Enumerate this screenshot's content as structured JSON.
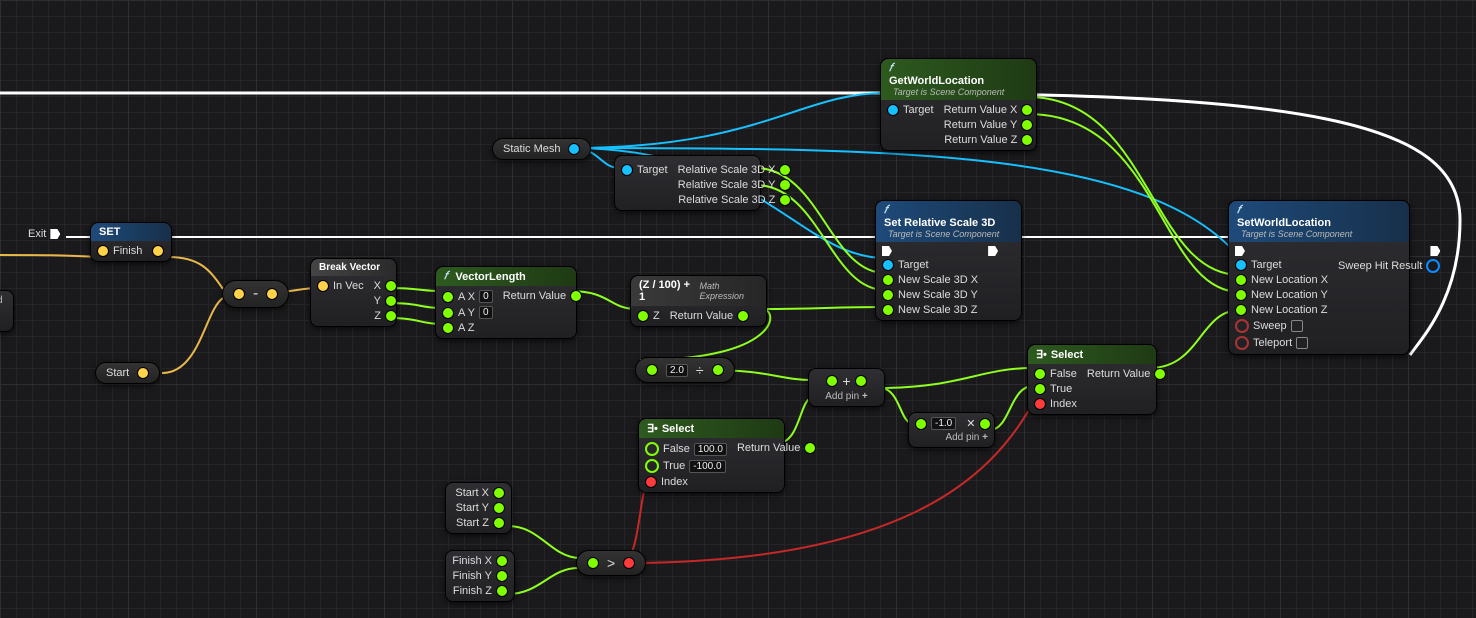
{
  "nodes": {
    "exit": {
      "label": "Exit"
    },
    "set": {
      "title": "SET",
      "pin": "Finish"
    },
    "start": {
      "label": "Start"
    },
    "subtract": {
      "op": "-"
    },
    "breakvec": {
      "title": "Break Vector",
      "in": "In Vec",
      "x": "X",
      "y": "Y",
      "z": "Z"
    },
    "veclen": {
      "title": "VectorLength",
      "ax": "A X",
      "ay": "A Y",
      "az": "A Z",
      "axv": "0",
      "ayv": "0",
      "ret": "Return Value"
    },
    "staticmesh": {
      "label": "Static Mesh"
    },
    "relscale": {
      "target": "Target",
      "x": "Relative Scale 3D X",
      "y": "Relative Scale 3D Y",
      "z": "Relative Scale 3D Z"
    },
    "mathexpr": {
      "title": "(Z / 100) + 1",
      "sub": "Math Expression",
      "in": "Z",
      "ret": "Return Value"
    },
    "divide": {
      "op": "÷",
      "val": "2.0"
    },
    "select1": {
      "title": "Select",
      "false": "False",
      "true": "True",
      "index": "Index",
      "ret": "Return Value",
      "fv": "100.0",
      "tv": "-100.0"
    },
    "addpin": {
      "label": "Add pin",
      "plus": "+"
    },
    "multnode": {
      "val": "-1.0",
      "label": "Add pin",
      "plus": "+"
    },
    "select2": {
      "title": "Select",
      "false": "False",
      "true": "True",
      "index": "Index",
      "ret": "Return Value"
    },
    "getworld": {
      "title": "GetWorldLocation",
      "sub": "Target is Scene Component",
      "target": "Target",
      "rx": "Return Value X",
      "ry": "Return Value Y",
      "rz": "Return Value Z"
    },
    "setrel": {
      "title": "Set Relative Scale 3D",
      "sub": "Target is Scene Component",
      "target": "Target",
      "x": "New Scale 3D X",
      "y": "New Scale 3D Y",
      "z": "New Scale 3D Z"
    },
    "setworld": {
      "title": "SetWorldLocation",
      "sub": "Target is Scene Component",
      "target": "Target",
      "x": "New Location X",
      "y": "New Location Y",
      "z": "New Location Z",
      "sweep": "Sweep",
      "tele": "Teleport",
      "hit": "Sweep Hit Result"
    },
    "startvec": {
      "x": "Start X",
      "y": "Start Y",
      "z": "Start Z"
    },
    "finishvec": {
      "x": "Finish X",
      "y": "Finish Y",
      "z": "Finish Z"
    },
    "gt": {
      "op": ">"
    },
    "partial": {
      "d": "d"
    }
  }
}
